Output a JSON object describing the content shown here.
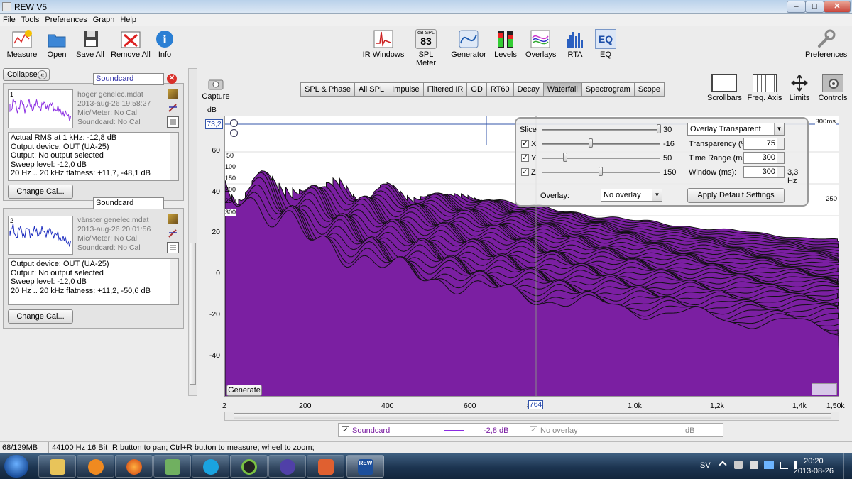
{
  "window": {
    "title": "REW V5"
  },
  "menu": [
    "File",
    "Tools",
    "Preferences",
    "Graph",
    "Help"
  ],
  "toolbar_left": [
    {
      "label": "Measure",
      "icon": "measure-icon"
    },
    {
      "label": "Open",
      "icon": "folder-icon"
    },
    {
      "label": "Save All",
      "icon": "save-icon"
    },
    {
      "label": "Remove All",
      "icon": "remove-icon"
    },
    {
      "label": "Info",
      "icon": "info-icon"
    }
  ],
  "toolbar_center": [
    {
      "label": "IR Windows",
      "icon": "ir-windows-icon"
    },
    {
      "label": "SPL Meter",
      "icon": "spl-meter-icon",
      "badge_top": "dB SPL",
      "badge_value": "83"
    },
    {
      "label": "Generator",
      "icon": "generator-icon"
    },
    {
      "label": "Levels",
      "icon": "levels-icon"
    },
    {
      "label": "Overlays",
      "icon": "overlays-icon"
    },
    {
      "label": "RTA",
      "icon": "rta-icon"
    },
    {
      "label": "EQ",
      "icon": "eq-icon",
      "badge_value": "EQ"
    }
  ],
  "toolbar_right": {
    "label": "Preferences",
    "icon": "wrench-icon"
  },
  "graph_toolbar": [
    {
      "label": "Scrollbars",
      "icon": "scrollbars-icon"
    },
    {
      "label": "Freq. Axis",
      "icon": "freq-axis-icon"
    },
    {
      "label": "Limits",
      "icon": "limits-icon"
    },
    {
      "label": "Controls",
      "icon": "controls-icon"
    }
  ],
  "capture": {
    "label": "Capture"
  },
  "collapse_label": "Collapse",
  "measurements": [
    {
      "index": "1",
      "name_field": "Soundcard",
      "file": "höger genelec.mdat",
      "date": "2013-aug-26 19:58:27",
      "mic": "Mic/Meter: No Cal",
      "soundcard": "Soundcard: No Cal",
      "info_lines": [
        "Actual RMS at 1 kHz: -12,8 dB",
        "Output device: OUT (UA-25)",
        "Output: No output selected",
        "Sweep level: -12,0 dB",
        "20 Hz .. 20 kHz flatness: +11,7, -48,1 dB"
      ],
      "change_cal": "Change Cal...",
      "color": "#8a2be2"
    },
    {
      "index": "2",
      "name_field": "Soundcard",
      "file": "vänster genelec.mdat",
      "date": "2013-aug-26 20:01:56",
      "mic": "Mic/Meter: No Cal",
      "soundcard": "Soundcard: No Cal",
      "info_lines": [
        "Output device: OUT (UA-25)",
        "Output: No output selected",
        "Sweep level: -12,0 dB",
        "20 Hz .. 20 kHz flatness: +11,2, -50,6 dB"
      ],
      "change_cal": "Change Cal...",
      "color": "#2030c0"
    }
  ],
  "tabs": [
    "SPL & Phase",
    "All SPL",
    "Impulse",
    "Filtered IR",
    "GD",
    "RT60",
    "Decay",
    "Waterfall",
    "Spectrogram",
    "Scope"
  ],
  "selected_tab": "Waterfall",
  "chart_data": {
    "type": "area",
    "ylabel": "dB",
    "y_ticks": [
      "60",
      "40",
      "20",
      "0",
      "-20",
      "-40"
    ],
    "ylim": [
      -55,
      76
    ],
    "x_ticks": [
      "2",
      "200",
      "400",
      "600",
      "800",
      "1,0k",
      "1,2k",
      "1,4k",
      "1,50k Hz"
    ],
    "xlim": [
      2,
      1500
    ],
    "cursor_y_value": "73,2",
    "cursor_x_value": "764",
    "z_ticks": [
      "50",
      "100",
      "150",
      "200",
      "250",
      "300"
    ],
    "z_label_right_top": "300ms",
    "z_labels_right": [
      "250",
      "200"
    ],
    "series": [
      {
        "name": "Soundcard",
        "color": "#7b1fa2",
        "slices": 40
      }
    ]
  },
  "controls": {
    "slice_label": "Slice",
    "slice_value": "30",
    "x_label": "X",
    "x_value": "-16",
    "x_checked": true,
    "y_label": "Y",
    "y_value": "50",
    "y_checked": true,
    "z_label": "Z",
    "z_value": "150",
    "z_checked": true,
    "overlay_mode": "Overlay Transparent",
    "transparency_label": "Transparency (%)",
    "transparency_value": "75",
    "time_range_label": "Time Range (ms):",
    "time_range_value": "300",
    "window_label": "Window (ms):",
    "window_value": "300",
    "window_hz": "3,3 Hz",
    "overlay_label": "Overlay:",
    "overlay_value": "No overlay",
    "apply_label": "Apply Default Settings"
  },
  "generate_label": "Generate",
  "legend": {
    "name": "Soundcard",
    "value": "-2,8 dB",
    "overlay_name": "No overlay",
    "overlay_unit": "dB",
    "line_color": "#8a2be2"
  },
  "status": {
    "memory": "68/129MB",
    "rate": "44100 Hz",
    "bits": "16 Bit",
    "hint": "R button to pan; Ctrl+R button to measure; wheel to zoom;"
  },
  "taskbar": {
    "lang": "SV",
    "time": "20:20",
    "date": "2013-08-26",
    "rew_label": "REW"
  }
}
